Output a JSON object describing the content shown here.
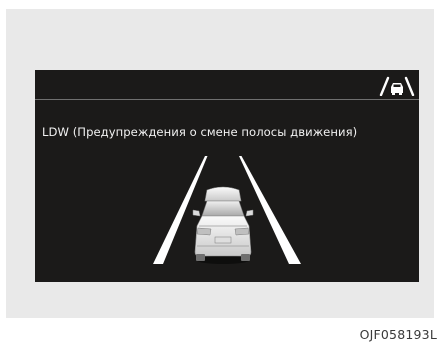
{
  "display": {
    "message": "LDW (Предупреждения о смене полосы движения)",
    "status_icon": "lane-departure-warning-icon",
    "illustration": "car-between-lane-lines",
    "colors": {
      "screen": "#1b1a19",
      "text": "#f2f2f2",
      "lane_lines": "#ffffff"
    }
  },
  "caption": {
    "code": "OJF058193L"
  }
}
